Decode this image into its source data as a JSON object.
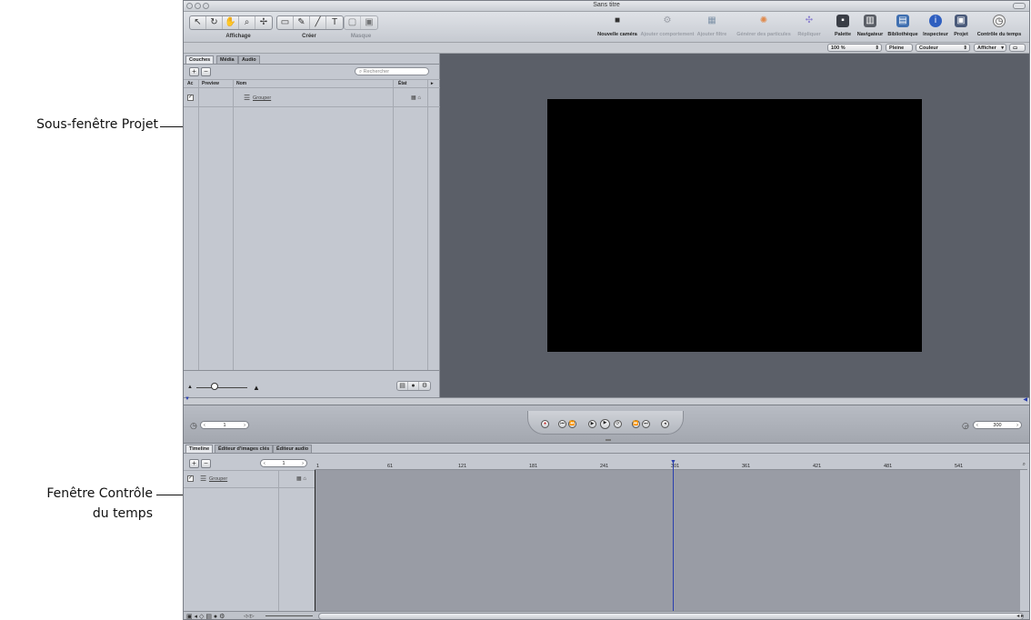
{
  "callouts": {
    "project_pane": "Sous-fenêtre Projet",
    "timing_line1": "Fenêtre Contrôle",
    "timing_line2": "du temps"
  },
  "window": {
    "title": "Sans titre"
  },
  "toolbar": {
    "group_labels": {
      "view": "Affichage",
      "create": "Créer",
      "mask": "Masque"
    },
    "right_items": [
      {
        "label": "Nouvelle caméra",
        "icon": "camera-icon",
        "enabled": true
      },
      {
        "label": "Ajouter comportement",
        "icon": "gear-icon",
        "enabled": false
      },
      {
        "label": "Ajouter filtre",
        "icon": "filter-icon",
        "enabled": false
      },
      {
        "label": "Générer des particules",
        "icon": "particles-icon",
        "enabled": false
      },
      {
        "label": "Répliquer",
        "icon": "replicate-icon",
        "enabled": false
      },
      {
        "label": "Palette",
        "icon": "palette-icon",
        "enabled": true
      },
      {
        "label": "Navigateur",
        "icon": "browser-icon",
        "enabled": true
      },
      {
        "label": "Bibliothèque",
        "icon": "library-icon",
        "enabled": true
      },
      {
        "label": "Inspecteur",
        "icon": "inspector-icon",
        "enabled": true
      },
      {
        "label": "Projet",
        "icon": "project-icon",
        "enabled": true
      },
      {
        "label": "Contrôle du temps",
        "icon": "clock-icon",
        "enabled": true
      }
    ]
  },
  "options_bar": {
    "zoom": "100 %",
    "resolution": "Pleine",
    "channels": "Couleur",
    "view_menu": "Afficher"
  },
  "project_pane": {
    "tabs": [
      "Couches",
      "Média",
      "Audio"
    ],
    "search_placeholder": "Rechercher",
    "columns": {
      "active": "Ac",
      "preview": "Preview",
      "name": "Nom",
      "state": "État"
    },
    "rows": [
      {
        "name": "Grouper",
        "checked": true
      }
    ]
  },
  "transport": {
    "start_frame": "1",
    "end_frame": "300"
  },
  "timeline": {
    "tabs": [
      "Timeline",
      "Éditeur d'images clés",
      "Éditeur audio"
    ],
    "current_frame": "1",
    "ruler_marks": [
      "1",
      "61",
      "121",
      "181",
      "241",
      "301",
      "361",
      "421",
      "481",
      "541"
    ],
    "rows": [
      {
        "name": "Grouper",
        "checked": true
      }
    ]
  },
  "colors": {
    "canvas_bg": "#5b5f68",
    "stage": "#000000",
    "playhead": "#2a3fae",
    "record": "#c02020"
  }
}
